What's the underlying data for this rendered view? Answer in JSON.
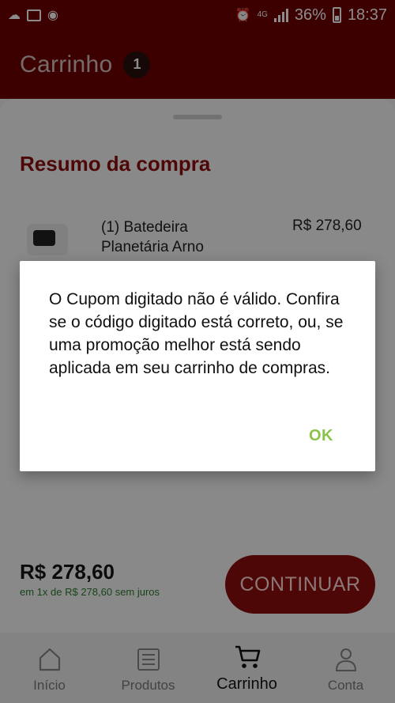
{
  "status_bar": {
    "network": "4G",
    "battery": "36%",
    "time": "18:37",
    "icons": [
      "cloud-icon",
      "image-icon",
      "eye-icon",
      "alarm-icon",
      "signal-icon",
      "battery-icon"
    ]
  },
  "app_bar": {
    "title": "Carrinho",
    "cart_count": "1"
  },
  "summary": {
    "title": "Resumo da compra",
    "item_name": "(1) Batedeira Planetária Arno",
    "item_price": "R$ 278,60"
  },
  "totals": {
    "total": "R$ 278,60",
    "installments": "em 1x de R$ 278,60 sem juros",
    "continue_label": "CONTINUAR"
  },
  "dialog": {
    "message": "O Cupom digitado não é válido. Confira se o código digitado está correto, ou, se uma promoção melhor está sendo aplicada em seu carrinho de compras.",
    "ok_label": "OK"
  },
  "bottom_nav": {
    "items": [
      {
        "label": "Início",
        "icon": "home-icon"
      },
      {
        "label": "Produtos",
        "icon": "list-icon"
      },
      {
        "label": "Carrinho",
        "icon": "cart-icon"
      },
      {
        "label": "Conta",
        "icon": "user-icon"
      }
    ],
    "active": "Carrinho"
  },
  "colors": {
    "brand": "#6e0000",
    "accent": "#8f0d0d",
    "ok": "#8bc34a",
    "installments": "#2e7d32"
  }
}
